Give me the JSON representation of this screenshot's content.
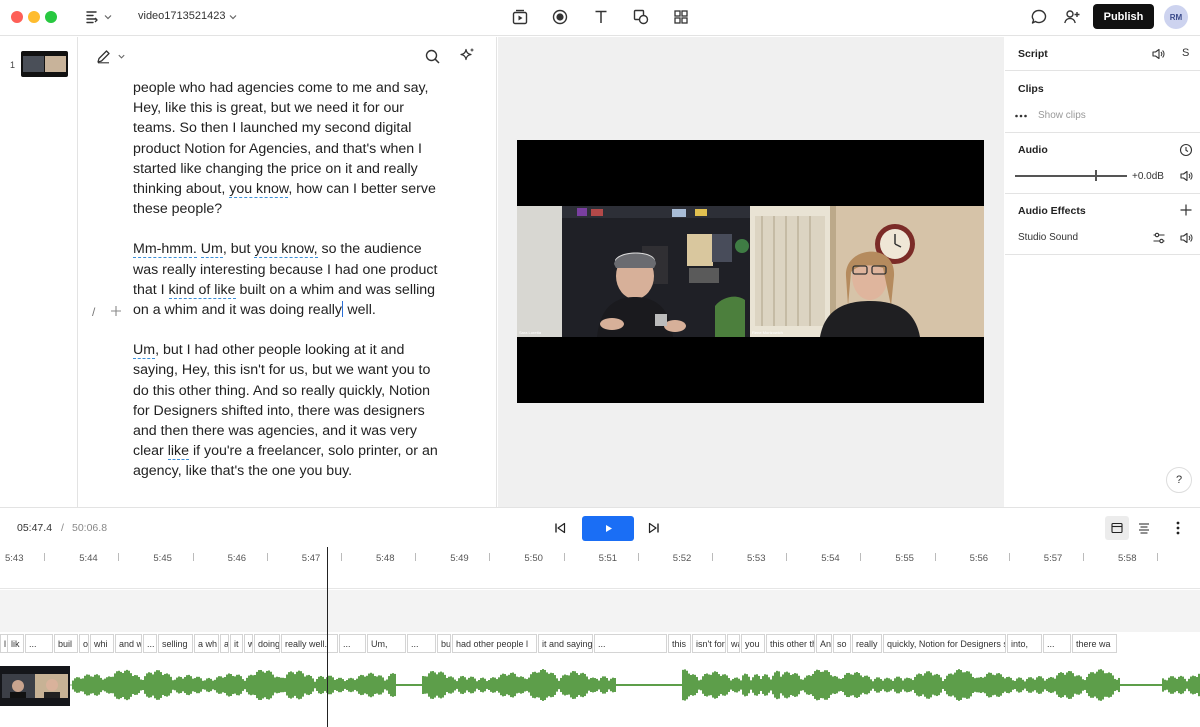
{
  "app": {
    "file_title": "video1713521423",
    "publish_label": "Publish",
    "avatar_initials": "RM"
  },
  "scenes": [
    {
      "number": "1"
    }
  ],
  "transcript": {
    "paragraphs": [
      [
        {
          "t": "people who had agencies come to me and say, Hey, like this is great, but we need it for our teams. So then I launched my second digital product Notion for Agencies, and that's when I started like changing the price on it and really thinking about, "
        },
        {
          "t": "you know",
          "filler": true
        },
        {
          "t": ", how can I better serve these people?"
        }
      ],
      [
        {
          "t": "Mm-hmm.",
          "filler": true
        },
        {
          "t": " "
        },
        {
          "t": "Um",
          "filler": true
        },
        {
          "t": ", but "
        },
        {
          "t": "you know,",
          "filler": true
        },
        {
          "t": " so the audience was really interesting because I had one product that I "
        },
        {
          "t": "kind of like",
          "filler": true
        },
        {
          "t": " built on a whim and was selling on a whim and it was doing really"
        },
        {
          "caret": true
        },
        {
          "t": " well."
        }
      ],
      [
        {
          "t": "Um",
          "filler": true
        },
        {
          "t": ", but I had other people looking at it and saying, Hey, this isn't for us, but we want you to do this other thing. And so really quickly, Notion for Designers shifted into, there was designers and then there was agencies, and it was very clear "
        },
        {
          "t": "like",
          "filler": true
        },
        {
          "t": " if you're a freelancer, solo printer, or an agency, like that's the one you buy."
        }
      ]
    ],
    "gutter_slash": "/"
  },
  "preview": {
    "left_speaker": "Sara Loretta",
    "right_speaker": "Rene Mortzowich"
  },
  "properties": {
    "script_label": "Script",
    "script_letter": "S",
    "clips_label": "Clips",
    "show_clips": "Show clips",
    "audio_label": "Audio",
    "audio_gain": "+0.0dB",
    "audio_level": 0.72,
    "effects_label": "Audio Effects",
    "studio_sound": "Studio Sound",
    "help": "?"
  },
  "transport": {
    "current_time": "05:47.4",
    "separator": "/",
    "total_time": "50:06.8"
  },
  "timeline": {
    "ticks": [
      "5:43",
      "5:44",
      "5:45",
      "5:46",
      "5:47",
      "5:48",
      "5:49",
      "5:50",
      "5:51",
      "5:52",
      "5:53",
      "5:54",
      "5:55",
      "5:56",
      "5:57",
      "5:58"
    ],
    "words": [
      "l",
      "lik",
      "...",
      "buil",
      "o",
      "whi",
      "and w",
      "...",
      "selling",
      "a wh",
      "a",
      "it",
      "w",
      "doing",
      "really well.",
      "...",
      "Um,",
      "...",
      "bu",
      "had other people l",
      "it and saying",
      "...",
      "this",
      "isn't for us, b",
      "wa",
      "you",
      "this other th",
      "An",
      "so",
      "really",
      "quickly, Notion for Designers shift",
      "into,",
      "...",
      "there wa"
    ]
  },
  "colors": {
    "accent": "#1a6ef5",
    "waveform": "#5d9e4a",
    "filler_underline": "#3b8fd9",
    "publish_bg": "#111111"
  }
}
